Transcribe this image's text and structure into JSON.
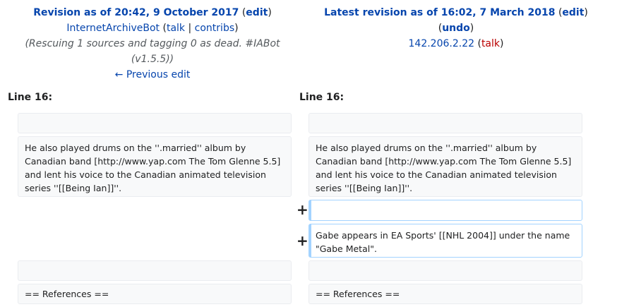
{
  "left_header": {
    "title": "Revision as of 20:42, 9 October 2017",
    "edit_label": "edit",
    "user": "InternetArchiveBot",
    "talk_label": "talk",
    "contribs_label": "contribs",
    "summary_line1": "(Rescuing 1 sources and tagging 0 as dead. #IABot",
    "summary_line2": "(v1.5.5))",
    "prev_edit_label": "← Previous edit"
  },
  "right_header": {
    "title": "Latest revision as of 16:02, 7 March 2018",
    "edit_label": "edit",
    "undo_label": "undo",
    "user_ip": "142.206.2.22",
    "talk_label": "talk"
  },
  "line_label": "Line 16:",
  "rows": {
    "context_text": "He also played drums on the ''.married'' album by Canadian band [http://www.yap.com The Tom Glenne 5.5] and lent his voice to the Canadian animated television series ''[[Being Ian]]''.",
    "added_text": "Gabe appears in EA Sports' [[NHL 2004]] under the name \"Gabe Metal\".",
    "references_text": "== References ==",
    "plus_marker": "+"
  }
}
